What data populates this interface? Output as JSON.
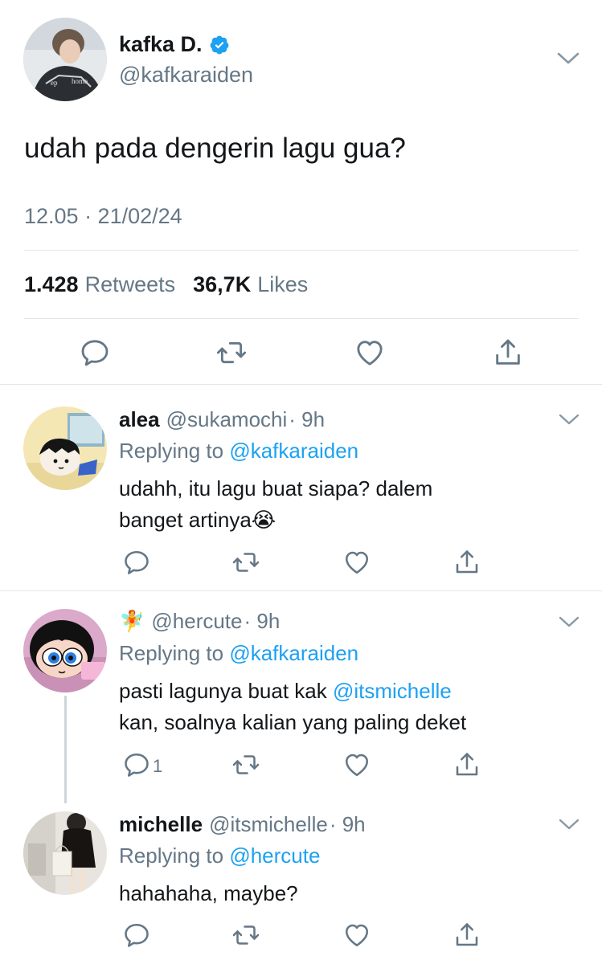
{
  "tweet": {
    "name": "kafka D.",
    "handle": "@kafkaraiden",
    "text": "udah pada dengerin lagu gua?",
    "timestamp": "12.05 · 21/02/24",
    "retweets_count": "1.428",
    "retweets_label": "Retweets",
    "likes_count": "36,7K",
    "likes_label": "Likes",
    "verified": true
  },
  "replies": [
    {
      "name": "alea",
      "handle": "@sukamochi",
      "time": "· 9h",
      "replying_prefix": "Replying to",
      "replying_to": "@kafkaraiden",
      "line1": "udahh, itu lagu buat siapa? dalem",
      "line2": "banget artinya",
      "emoji": "😭",
      "reply_count": ""
    },
    {
      "name_emoji": "🧚",
      "handle": "@hercute",
      "time": "· 9h",
      "replying_prefix": "Replying to",
      "replying_to": "@kafkaraiden",
      "line1_prefix": "pasti lagunya buat kak",
      "line1_mention": "@itsmichelle",
      "line2": "kan, soalnya kalian yang paling deket",
      "reply_count": "1"
    },
    {
      "name": "michelle",
      "handle": "@itsmichelle",
      "time": "· 9h",
      "replying_prefix": "Replying to",
      "replying_to": "@hercute",
      "line1": "hahahaha, maybe?",
      "reply_count": ""
    }
  ],
  "colors": {
    "link": "#1da1f2",
    "muted": "#657786",
    "text": "#14171a",
    "divider": "#e1e8ed"
  },
  "icons": [
    "reply-icon",
    "retweet-icon",
    "like-icon",
    "share-icon",
    "chevron-down-icon",
    "verified-badge-icon"
  ]
}
